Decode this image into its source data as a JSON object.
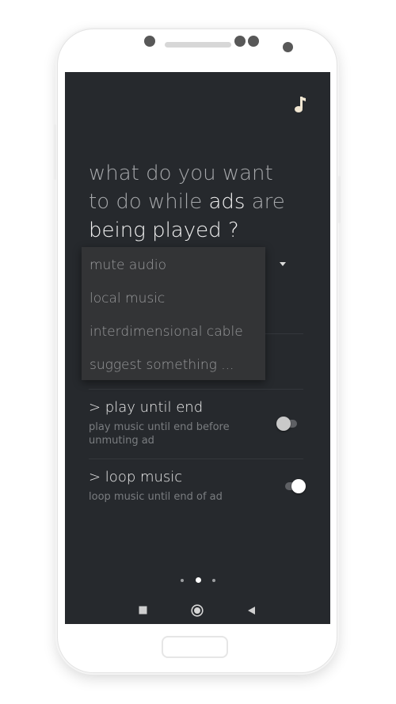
{
  "question": {
    "part1": "what do you want",
    "part2": "to do while ",
    "part3": "ads",
    "part4": " are",
    "part5": "being played ?"
  },
  "dropdown_menu": {
    "items": [
      "mute audio",
      "local music",
      "interdimensional cable",
      "suggest something ..."
    ]
  },
  "options": [
    {
      "title": "> play until end",
      "description": "play music until end before unmuting ad",
      "enabled": false
    },
    {
      "title": "> loop music",
      "description": "loop music until end of ad",
      "enabled": true
    }
  ],
  "pager": {
    "pages": 3,
    "current": 2
  },
  "icons": {
    "top_right": "music-note-icon",
    "nav": [
      "recents-square-icon",
      "home-circle-icon",
      "back-triangle-icon"
    ]
  },
  "colors": {
    "screen_bg": "#26292d",
    "menu_bg": "#333436",
    "text_primary": "#f2f2f2",
    "text_secondary": "#a6a8ab"
  }
}
